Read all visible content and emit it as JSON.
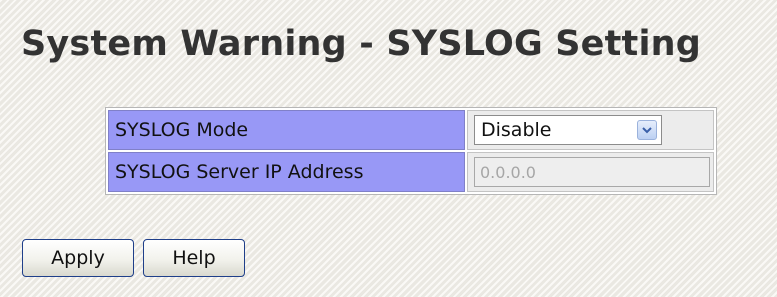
{
  "page": {
    "title": "System Warning - SYSLOG Setting"
  },
  "settings": {
    "rows": [
      {
        "label": "SYSLOG Mode",
        "value": "Disable",
        "options": [
          "Disable"
        ]
      },
      {
        "label": "SYSLOG Server IP Address",
        "value": "0.0.0.0",
        "disabled": true
      }
    ]
  },
  "buttons": {
    "apply_label": "Apply",
    "help_label": "Help"
  },
  "icons": {
    "dropdown": "chevron-down-icon"
  },
  "colors": {
    "label_background": "#9898f6",
    "page_background": "#f3f1ea",
    "button_border": "#1f3f8a"
  }
}
